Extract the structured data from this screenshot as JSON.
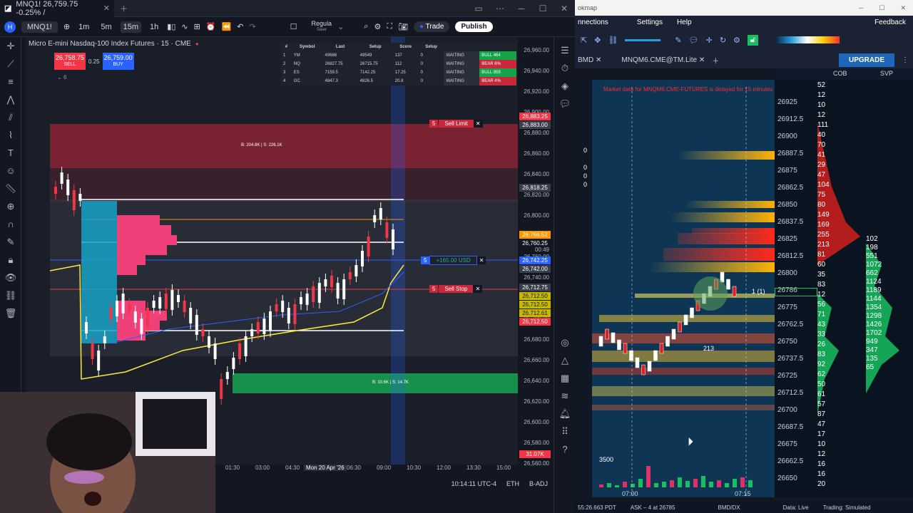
{
  "tv": {
    "tab_title": "MNQ1! 26,759.75 -0.25% /",
    "symbol": "MNQ1!",
    "intervals": [
      "1m",
      "5m",
      "15m",
      "1h"
    ],
    "indicator_label": "Regula",
    "indicator_sub": "Save",
    "trade_label": "Trade",
    "publish_label": "Publish",
    "chart_title": "Micro E-mini Nasdaq-100 Index Futures · 15 · CME",
    "sell_price": "26,758.75",
    "sell_label": "SELL",
    "spread": "0.25",
    "buy_price": "26,759.00",
    "buy_label": "BUY",
    "lots": "6",
    "table_headers": [
      "#",
      "Symbol",
      "Last",
      "Setup",
      "Score",
      "Setup"
    ],
    "table_rows": [
      {
        "n": "1",
        "sym": "YM",
        "a": "49686",
        "b": "49549",
        "c": "137",
        "score": "0",
        "state": "WAITING",
        "tag": "BULL 464"
      },
      {
        "n": "2",
        "sym": "NQ",
        "a": "26827.75",
        "b": "26715.75",
        "c": "112",
        "score": "0",
        "state": "WAITING",
        "tag": "BEAR 6%"
      },
      {
        "n": "3",
        "sym": "ES",
        "a": "7159.5",
        "b": "7142.25",
        "c": "17.25",
        "score": "0",
        "state": "WAITING",
        "tag": "BULL 859"
      },
      {
        "n": "4",
        "sym": "GC",
        "a": "4847.3",
        "b": "4826.5",
        "c": "20.8",
        "score": "0",
        "state": "WAITING",
        "tag": "BEAR 4%"
      }
    ],
    "zone_top_label": "B: 204.8K | S: 226.1K",
    "zone_bottom_label": "B: 10.6K | S: 14.7K",
    "sell_limit": {
      "qty": "5",
      "label": "Sell Limit"
    },
    "profit": {
      "qty": "5",
      "label": "+165.00 USD"
    },
    "sell_stop": {
      "qty": "5",
      "label": "Sell Stop"
    },
    "price_ticks": [
      "26,960.00",
      "26,940.00",
      "26,920.00",
      "26,900.00",
      "26,880.00",
      "26,860.00",
      "26,840.00",
      "26,820.00",
      "26,800.00",
      "26,780.00",
      "26,760.00",
      "26,740.00",
      "26,720.00",
      "26,700.00",
      "26,680.00",
      "26,660.00",
      "26,640.00",
      "26,620.00",
      "26,600.00",
      "26,580.00",
      "26,560.00"
    ],
    "price_tags": [
      {
        "v": "26,883.25",
        "c": "#f23645"
      },
      {
        "v": "26,883.00",
        "c": "#3a3e4a"
      },
      {
        "v": "26,818.25",
        "c": "#3a3e4a"
      },
      {
        "v": "26,766.52",
        "c": "#ff9800"
      },
      {
        "v": "26,760.25",
        "c": "#131722"
      },
      {
        "v": "26,742.25",
        "c": "#2962ff"
      },
      {
        "v": "26,742.00",
        "c": "#3a3e4a"
      },
      {
        "v": "26,712.75",
        "c": "#3a3e4a"
      },
      {
        "v": "26,712.50",
        "c": "#c9b800"
      },
      {
        "v": "26,712.50",
        "c": "#c9b800"
      },
      {
        "v": "26,712.61",
        "c": "#c9b800"
      },
      {
        "v": "26,712.50",
        "c": "#f23645"
      }
    ],
    "countdown": "00:49",
    "volume_tag": "31.07K",
    "time_ticks": [
      "01:30",
      "03:00",
      "04:30",
      "Mon 20 Apr '26",
      "06:30",
      "09:00",
      "10:30",
      "12:00",
      "13:30",
      "15:00"
    ],
    "clock": "10:14:11 UTC-4",
    "session": "ETH",
    "adj": "B-ADJ"
  },
  "bm": {
    "app_title": "okmap",
    "menu": [
      "nnections",
      "Settings",
      "Help"
    ],
    "feedback": "Feedback",
    "tabs": [
      "BMD",
      "MNQM6.CME@TM.Lite"
    ],
    "upgrade_label": "UPGRADE",
    "col_cob": "COB",
    "col_svp": "SVP",
    "delay_notice": "Market data for MNQM6.CME-FUTURES is delayed for 15 minutes",
    "side_zeros": [
      "0",
      "0",
      "0",
      "0"
    ],
    "prices": [
      "26925",
      "26912.5",
      "26900",
      "26887.5",
      "26875",
      "26862.5",
      "26850",
      "26837.5",
      "26825",
      "26812.5",
      "26800",
      "26786",
      "26775",
      "26762.5",
      "26750",
      "26737.5",
      "26725",
      "26712.5",
      "26700",
      "26687.5",
      "26675",
      "26662.5",
      "26650"
    ],
    "cob": [
      "52",
      "12",
      "10",
      "12",
      "111",
      "40",
      "70",
      "41",
      "29",
      "47",
      "104",
      "75",
      "80",
      "149",
      "169",
      "255",
      "213",
      "81",
      "60",
      "35",
      "83",
      "12",
      "56",
      "71",
      "43",
      "33",
      "26",
      "83",
      "92",
      "62",
      "50",
      "61",
      "57",
      "87",
      "47",
      "17",
      "10",
      "12",
      "16",
      "16",
      "20"
    ],
    "svp": [
      "102",
      "198",
      "551",
      "1072",
      "662",
      "1124",
      "1189",
      "1144",
      "1354",
      "1298",
      "1426",
      "1702",
      "949",
      "347",
      "135",
      "65"
    ],
    "current_price": "26786",
    "order_marker": "1 (1)",
    "volume_bubble": "213",
    "heatmap_y_label": "3500",
    "heatmap_time": [
      "07:00",
      "07:15"
    ],
    "status": [
      "55:26.663 PDT",
      "ASK – 4 at 26785",
      "BMD/DX",
      "Data: Live",
      "Trading: Simulated"
    ]
  }
}
